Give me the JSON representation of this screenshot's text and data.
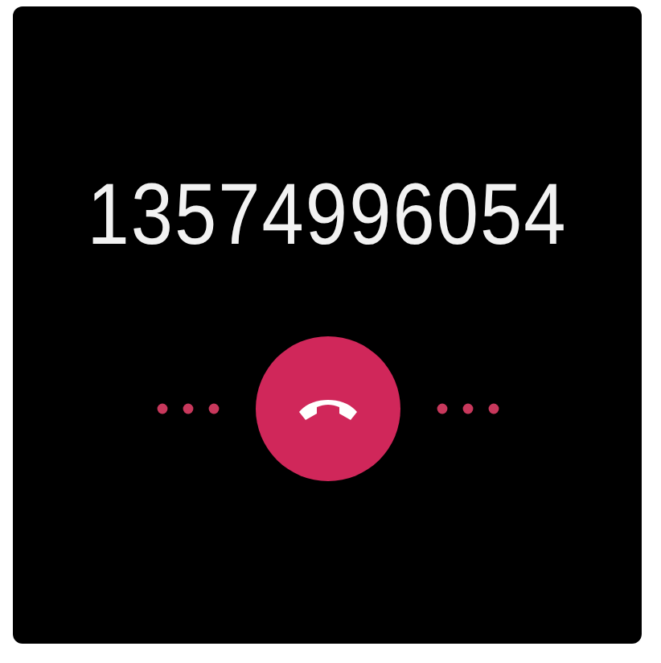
{
  "caller_number": "13574996054",
  "actions": [
    {
      "kind": "hang_up"
    }
  ]
}
